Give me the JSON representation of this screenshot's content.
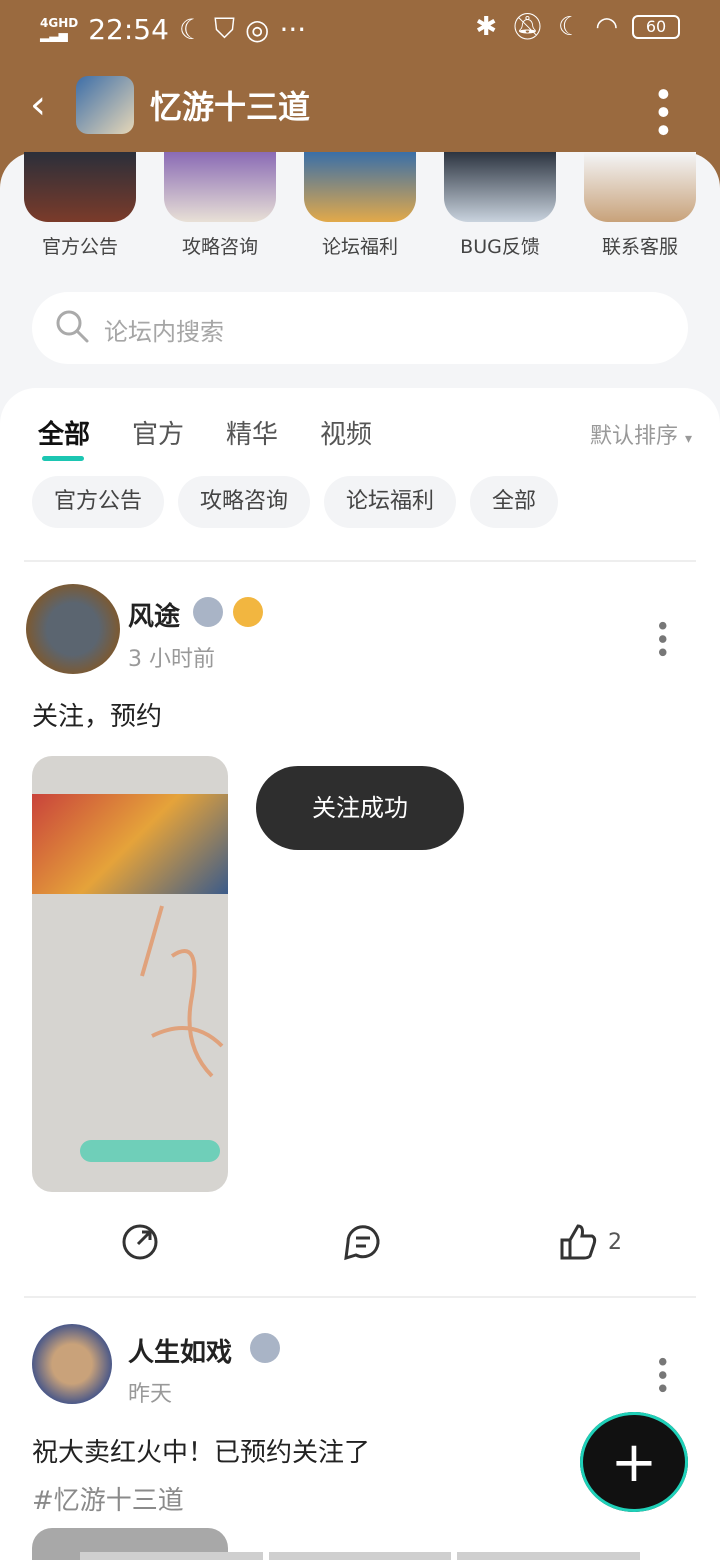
{
  "status_bar": {
    "network": "4GHD",
    "time": "22:54",
    "battery": "60"
  },
  "nav": {
    "title": "忆游十三道"
  },
  "shortcuts": [
    {
      "label": "官方公告"
    },
    {
      "label": "攻略咨询"
    },
    {
      "label": "论坛福利"
    },
    {
      "label": "BUG反馈"
    },
    {
      "label": "联系客服"
    }
  ],
  "search": {
    "placeholder": "论坛内搜索"
  },
  "tabs": [
    {
      "label": "全部"
    },
    {
      "label": "官方"
    },
    {
      "label": "精华"
    },
    {
      "label": "视频"
    }
  ],
  "sort": {
    "label": "默认排序"
  },
  "chips": [
    {
      "label": "官方公告"
    },
    {
      "label": "攻略咨询"
    },
    {
      "label": "论坛福利"
    },
    {
      "label": "全部"
    }
  ],
  "posts": [
    {
      "author": "风途",
      "time": "3 小时前",
      "text": "关注，预约",
      "likes": "2"
    },
    {
      "author": "人生如戏",
      "time": "昨天",
      "text": "祝大卖红火中！已预约关注了",
      "tag": "#忆游十三道"
    }
  ],
  "toast": {
    "text": "关注成功"
  },
  "colors": {
    "header": "#9a6a3f",
    "accent": "#1cc6b2",
    "background": "#f4f5f7"
  }
}
